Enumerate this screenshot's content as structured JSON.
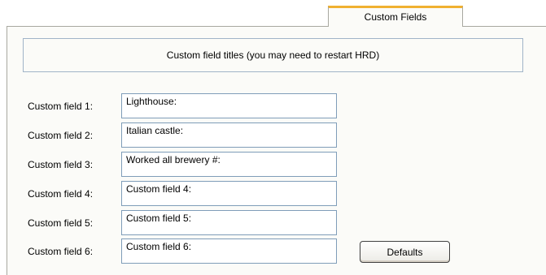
{
  "tab": {
    "label": "Custom Fields"
  },
  "group": {
    "title": "Custom field titles (you may need to restart HRD)"
  },
  "fields": [
    {
      "label": "Custom field 1:",
      "value": "Lighthouse:"
    },
    {
      "label": "Custom field 2:",
      "value": "Italian castle:"
    },
    {
      "label": "Custom field 3:",
      "value": "Worked all brewery #:"
    },
    {
      "label": "Custom field 4:",
      "value": "Custom field 4:"
    },
    {
      "label": "Custom field 5:",
      "value": "Custom field 5:"
    },
    {
      "label": "Custom field 6:",
      "value": "Custom field 6:"
    }
  ],
  "buttons": {
    "defaults_label": "Defaults"
  },
  "colors": {
    "tab_accent": "#f0b030",
    "panel_bg": "#fbfbf8",
    "input_border": "#7f9db9",
    "group_border": "#a0b4c8"
  }
}
